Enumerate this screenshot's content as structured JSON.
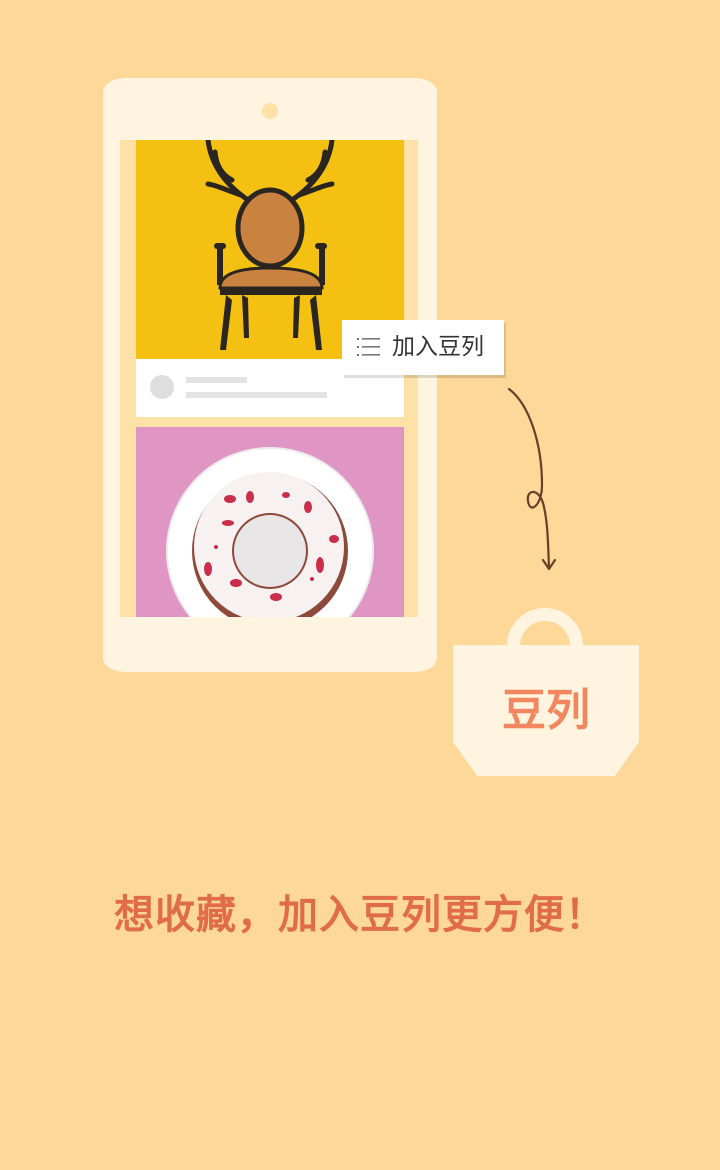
{
  "popup": {
    "label": "加入豆列",
    "icon": "list-icon"
  },
  "bag": {
    "label": "豆列",
    "icon": "tote-bag-icon"
  },
  "tagline": "想收藏，加入豆列更方便！",
  "colors": {
    "background": "#fdd899",
    "phone": "#fff4df",
    "accent_text": "#e06d48",
    "bag_text": "#f2875f",
    "card1_bg": "#f4c113",
    "card2_bg": "#e096c4"
  }
}
